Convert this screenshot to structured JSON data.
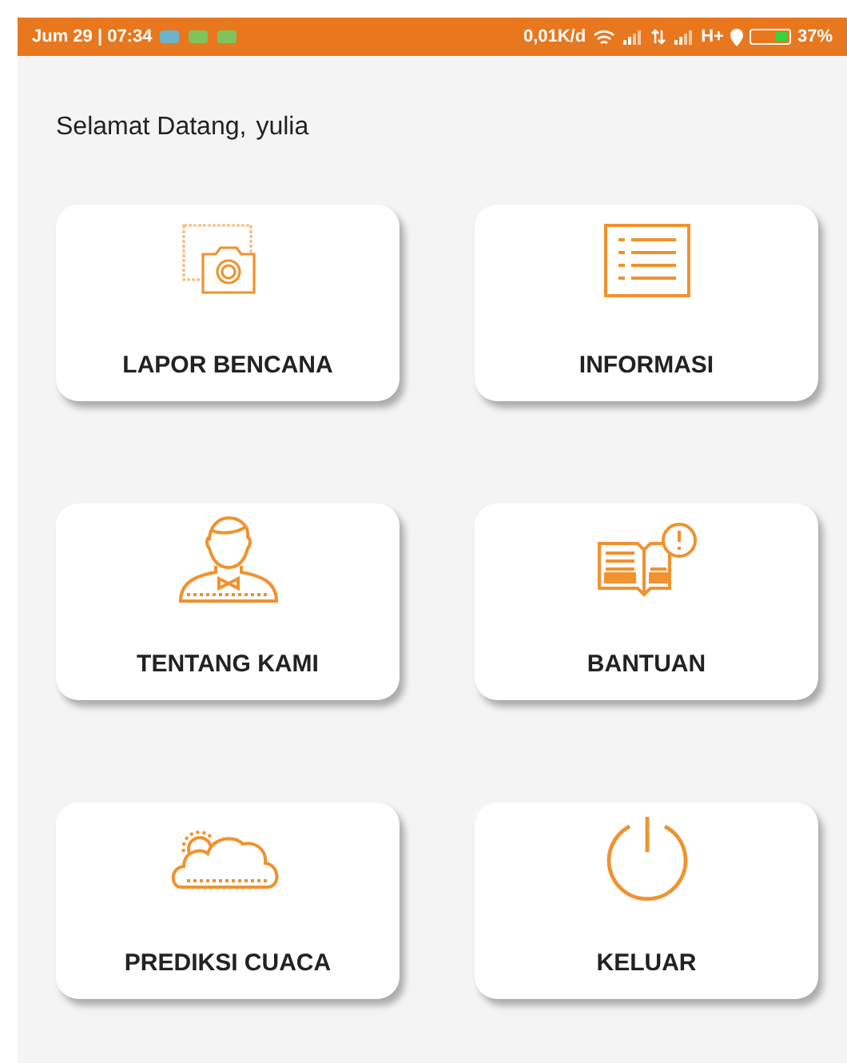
{
  "status_bar": {
    "time": "Jum 29 | 07:34",
    "speed": "0,01K/d",
    "network": "H+",
    "battery": {
      "text": "37%",
      "level": 0.37
    }
  },
  "greeting": {
    "text": "Selamat Datang,",
    "user": "yulia"
  },
  "menu": [
    {
      "kind": "camera",
      "label": "LAPOR BENCANA"
    },
    {
      "kind": "list",
      "label": "INFORMASI"
    },
    {
      "kind": "person",
      "label": "TENTANG KAMI"
    },
    {
      "kind": "book",
      "label": "BANTUAN"
    },
    {
      "kind": "weather",
      "label": "PREDIKSI CUACA"
    },
    {
      "kind": "power",
      "label": "KELUAR"
    }
  ]
}
